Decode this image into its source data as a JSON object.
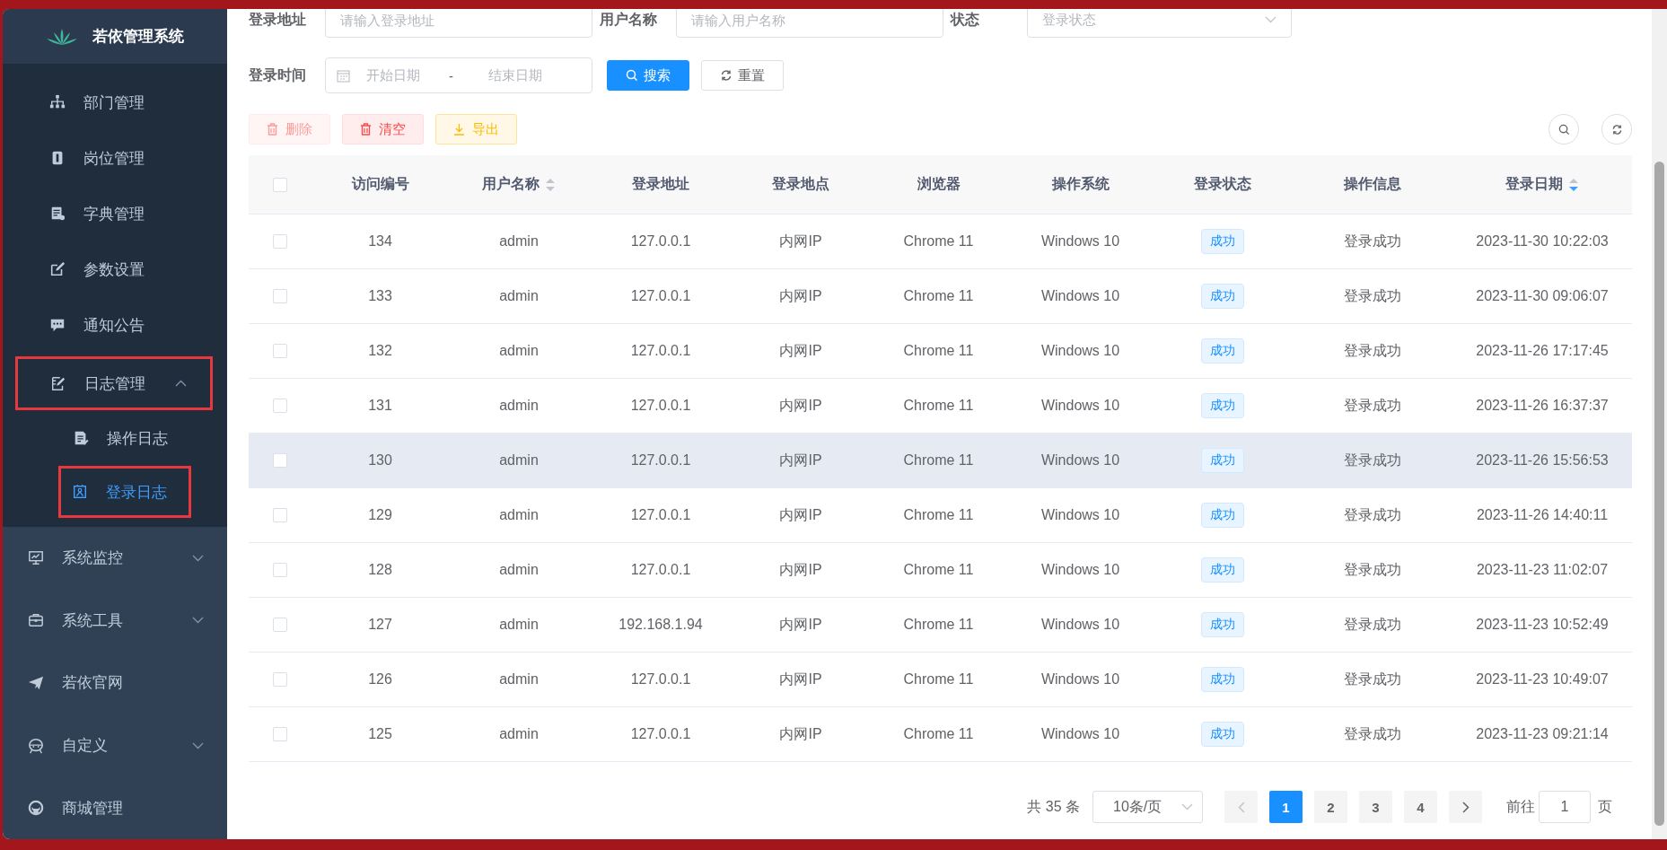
{
  "sidebar": {
    "title": "若依管理系统",
    "nested_items": [
      {
        "label": "部门管理",
        "kind": "link",
        "selected": false,
        "annotated": false
      },
      {
        "label": "岗位管理",
        "kind": "link",
        "selected": false,
        "annotated": false
      },
      {
        "label": "字典管理",
        "kind": "link",
        "selected": false,
        "annotated": false
      },
      {
        "label": "参数设置",
        "kind": "link",
        "selected": false,
        "annotated": false
      },
      {
        "label": "通知公告",
        "kind": "link",
        "selected": false,
        "annotated": false
      },
      {
        "label": "日志管理",
        "kind": "submenu",
        "expanded": true,
        "selected": false,
        "annotated": true,
        "children": [
          {
            "label": "操作日志",
            "selected": false,
            "annotated": false
          },
          {
            "label": "登录日志",
            "selected": true,
            "annotated": true
          }
        ]
      }
    ],
    "items": [
      {
        "label": "系统监控",
        "kind": "submenu",
        "expanded": false,
        "selected": false
      },
      {
        "label": "系统工具",
        "kind": "submenu",
        "expanded": false,
        "selected": false
      },
      {
        "label": "若依官网",
        "kind": "link",
        "selected": false
      },
      {
        "label": "自定义",
        "kind": "submenu",
        "expanded": false,
        "selected": false
      },
      {
        "label": "商城管理",
        "kind": "link",
        "selected": false
      }
    ]
  },
  "filters": {
    "fields": [
      {
        "label": "登录地址",
        "kind": "input",
        "placeholder": "请输入登录地址"
      },
      {
        "label": "用户名称",
        "kind": "input",
        "placeholder": "请输入用户名称"
      },
      {
        "label": "状态",
        "kind": "select",
        "placeholder": "登录状态"
      }
    ],
    "date_range": {
      "label": "登录时间",
      "start_placeholder": "开始日期",
      "separator": "-",
      "end_placeholder": "结束日期"
    },
    "buttons": [
      {
        "label": "搜索",
        "kind": "primary"
      },
      {
        "label": "重置",
        "kind": "default"
      }
    ]
  },
  "toolbar": {
    "buttons": [
      {
        "label": "删除",
        "kind": "danger",
        "disabled": true
      },
      {
        "label": "清空",
        "kind": "danger",
        "disabled": false
      },
      {
        "label": "导出",
        "kind": "warning",
        "disabled": false
      }
    ]
  },
  "table": {
    "select_all_checked": false,
    "columns": [
      {
        "label": "访问编号"
      },
      {
        "label": "用户名称",
        "sort_ascending": false,
        "sort_descending": false
      },
      {
        "label": "登录地址"
      },
      {
        "label": "登录地点"
      },
      {
        "label": "浏览器"
      },
      {
        "label": "操作系统"
      },
      {
        "label": "登录状态"
      },
      {
        "label": "操作信息"
      },
      {
        "label": "登录日期",
        "sort_ascending": false,
        "sort_descending": true
      }
    ],
    "rows": [
      {
        "checked": false,
        "highlighted": false,
        "cells": [
          "134",
          "admin",
          "127.0.0.1",
          "内网IP",
          "Chrome 11",
          "Windows 10",
          "成功",
          "登录成功",
          "2023-11-30 10:22:03"
        ]
      },
      {
        "checked": false,
        "highlighted": false,
        "cells": [
          "133",
          "admin",
          "127.0.0.1",
          "内网IP",
          "Chrome 11",
          "Windows 10",
          "成功",
          "登录成功",
          "2023-11-30 09:06:07"
        ]
      },
      {
        "checked": false,
        "highlighted": false,
        "cells": [
          "132",
          "admin",
          "127.0.0.1",
          "内网IP",
          "Chrome 11",
          "Windows 10",
          "成功",
          "登录成功",
          "2023-11-26 17:17:45"
        ]
      },
      {
        "checked": false,
        "highlighted": false,
        "cells": [
          "131",
          "admin",
          "127.0.0.1",
          "内网IP",
          "Chrome 11",
          "Windows 10",
          "成功",
          "登录成功",
          "2023-11-26 16:37:37"
        ]
      },
      {
        "checked": false,
        "highlighted": true,
        "cells": [
          "130",
          "admin",
          "127.0.0.1",
          "内网IP",
          "Chrome 11",
          "Windows 10",
          "成功",
          "登录成功",
          "2023-11-26 15:56:53"
        ]
      },
      {
        "checked": false,
        "highlighted": false,
        "cells": [
          "129",
          "admin",
          "127.0.0.1",
          "内网IP",
          "Chrome 11",
          "Windows 10",
          "成功",
          "登录成功",
          "2023-11-26 14:40:11"
        ]
      },
      {
        "checked": false,
        "highlighted": false,
        "cells": [
          "128",
          "admin",
          "127.0.0.1",
          "内网IP",
          "Chrome 11",
          "Windows 10",
          "成功",
          "登录成功",
          "2023-11-23 11:02:07"
        ]
      },
      {
        "checked": false,
        "highlighted": false,
        "cells": [
          "127",
          "admin",
          "192.168.1.94",
          "内网IP",
          "Chrome 11",
          "Windows 10",
          "成功",
          "登录成功",
          "2023-11-23 10:52:49"
        ]
      },
      {
        "checked": false,
        "highlighted": false,
        "cells": [
          "126",
          "admin",
          "127.0.0.1",
          "内网IP",
          "Chrome 11",
          "Windows 10",
          "成功",
          "登录成功",
          "2023-11-23 10:49:07"
        ]
      },
      {
        "checked": false,
        "highlighted": false,
        "cells": [
          "125",
          "admin",
          "127.0.0.1",
          "内网IP",
          "Chrome 11",
          "Windows 10",
          "成功",
          "登录成功",
          "2023-11-23 09:21:14"
        ]
      }
    ]
  },
  "pagination": {
    "total": "共 35 条",
    "page_size": "10条/页",
    "prev_disabled": true,
    "next_disabled": false,
    "pages": [
      {
        "label": "1",
        "selected": true
      },
      {
        "label": "2",
        "selected": false
      },
      {
        "label": "3",
        "selected": false
      },
      {
        "label": "4",
        "selected": false
      }
    ],
    "jump_label": "前往",
    "jump_value": "1",
    "jump_suffix": "页"
  }
}
